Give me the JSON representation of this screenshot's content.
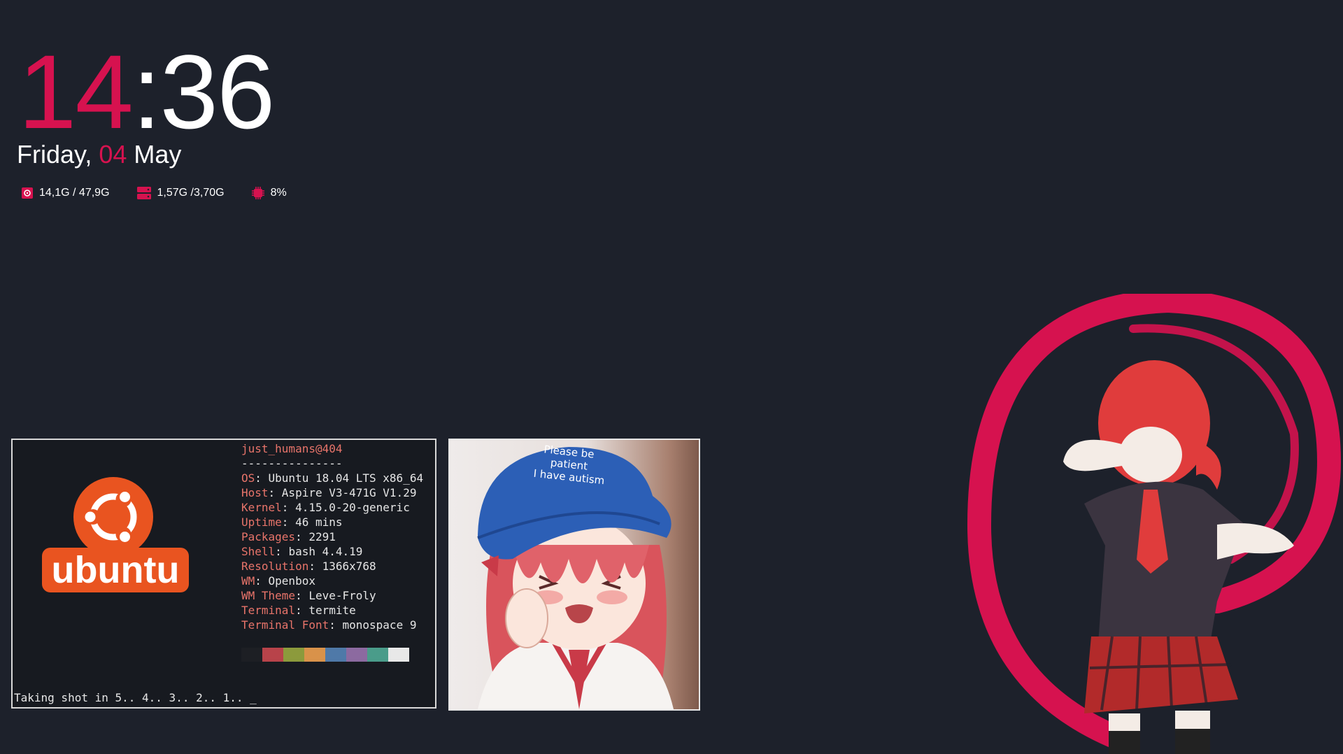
{
  "clock": {
    "hour": "14",
    "separator": ":",
    "minute": "36"
  },
  "date": {
    "weekday": "Friday, ",
    "day": "04",
    "month": " May"
  },
  "stats": {
    "disk": "14,1G / 47,9G",
    "memory": "1,57G /3,70G",
    "cpu": "8%"
  },
  "terminal": {
    "logo_text": "ubuntu",
    "user_host": "just_humans@404",
    "separator": "---------------",
    "info": [
      {
        "key": "OS",
        "value": "Ubuntu 18.04 LTS x86_64"
      },
      {
        "key": "Host",
        "value": "Aspire V3-471G V1.29"
      },
      {
        "key": "Kernel",
        "value": "4.15.0-20-generic"
      },
      {
        "key": "Uptime",
        "value": "46 mins"
      },
      {
        "key": "Packages",
        "value": "2291"
      },
      {
        "key": "Shell",
        "value": "bash 4.4.19"
      },
      {
        "key": "Resolution",
        "value": "1366x768"
      },
      {
        "key": "WM",
        "value": "Openbox"
      },
      {
        "key": "WM Theme",
        "value": "Leve-Froly"
      },
      {
        "key": "Terminal",
        "value": "termite"
      },
      {
        "key": "Terminal Font",
        "value": "monospace 9"
      }
    ],
    "palette": [
      "#1d1f24",
      "#b8434a",
      "#8c9a3c",
      "#d9924a",
      "#4f79a8",
      "#8c6aa0",
      "#4a9c8a",
      "#e8e8e8"
    ],
    "prompt": "Taking shot in 5.. 4.. 3.. 2.. 1.. _"
  },
  "image_viewer": {
    "cap_text_1": "Please be",
    "cap_text_2": "patient",
    "cap_text_3": "I have autism"
  },
  "colors": {
    "accent": "#d6124f",
    "background": "#1d212b",
    "ubuntu": "#e95420"
  }
}
